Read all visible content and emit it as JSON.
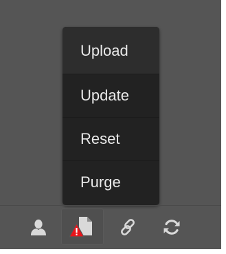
{
  "menu": {
    "items": [
      {
        "label": "Upload"
      },
      {
        "label": "Update"
      },
      {
        "label": "Reset"
      },
      {
        "label": "Purge"
      }
    ],
    "highlighted": "Upload"
  },
  "toolbar": {
    "buttons": [
      {
        "icon": "user-icon",
        "active": false
      },
      {
        "icon": "file-warning-icon",
        "active": true
      },
      {
        "icon": "link-icon",
        "active": false
      },
      {
        "icon": "refresh-icon",
        "active": false
      }
    ]
  },
  "colors": {
    "background": "#555555",
    "menu_background": "#222222",
    "menu_text": "#e9e9e9",
    "icon": "#d9d9d9",
    "warning": "#e8141a"
  }
}
